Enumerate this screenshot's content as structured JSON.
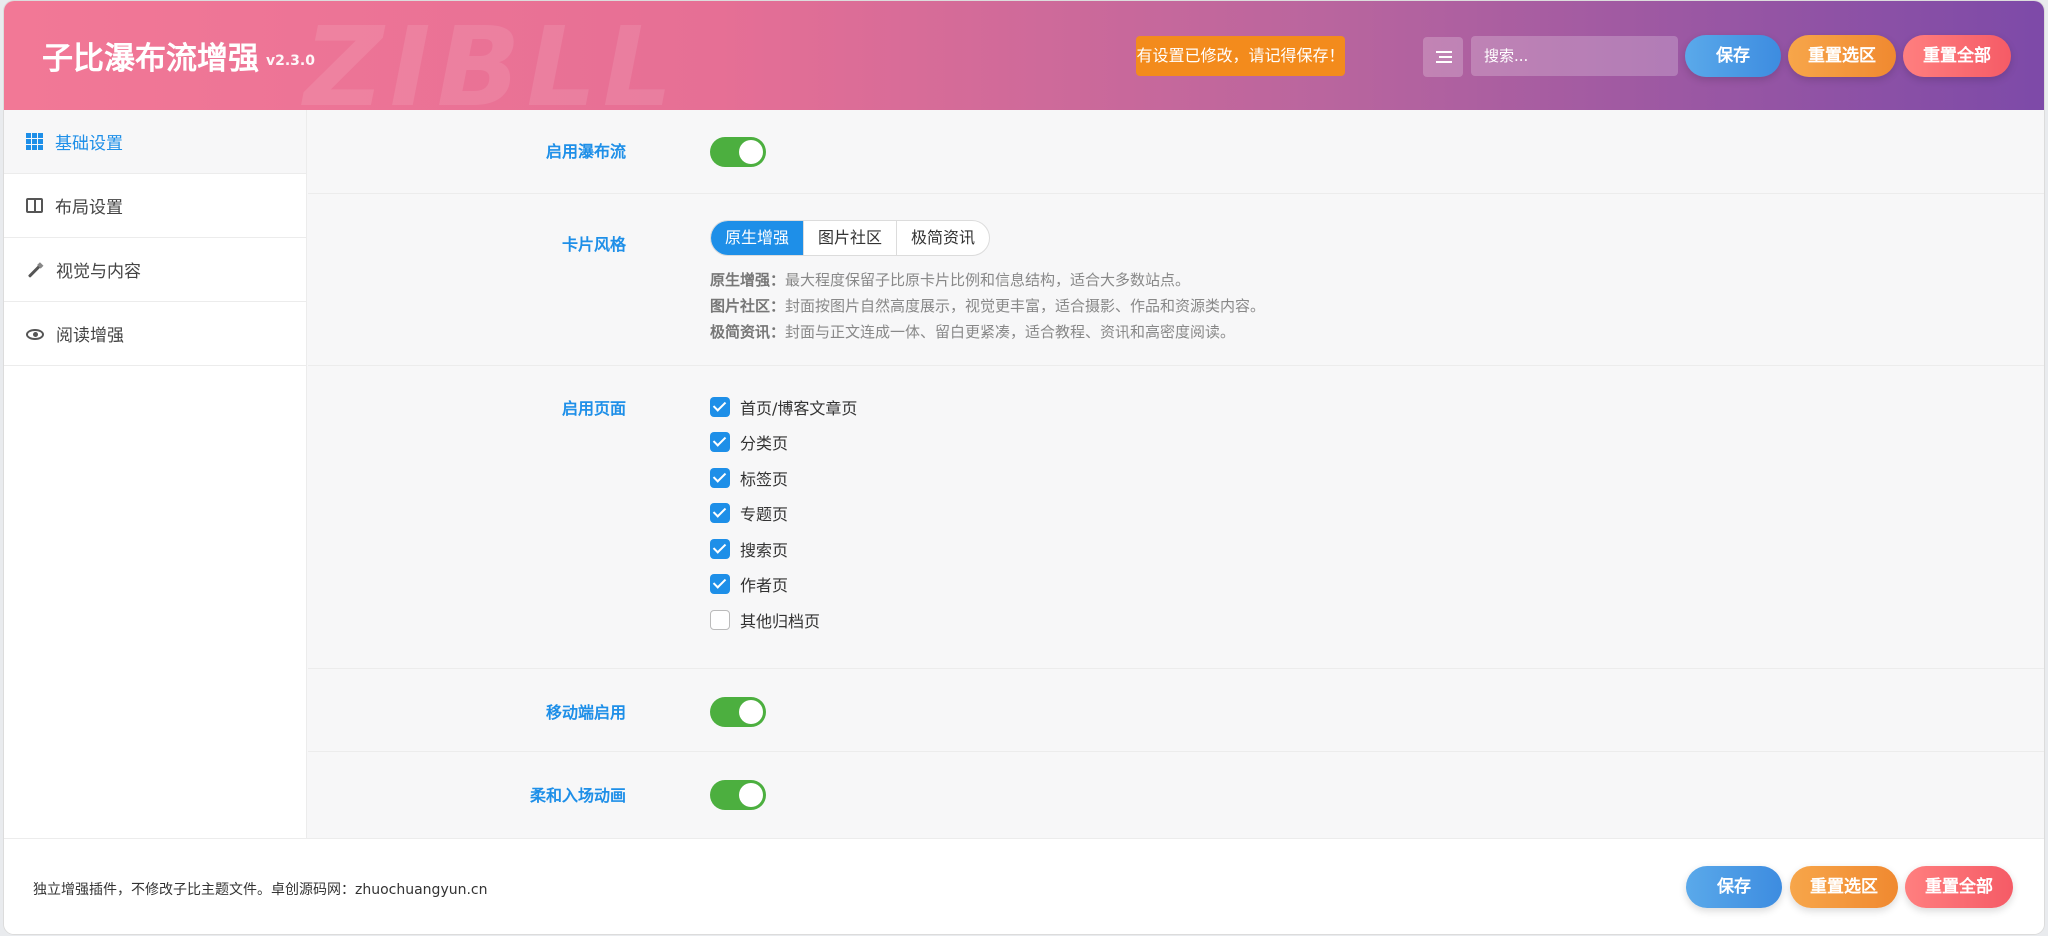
{
  "header": {
    "title": "子比瀑布流增强",
    "version": "v2.3.0",
    "watermark": "ZIBLL",
    "notice": "有设置已修改，请记得保存！",
    "search_placeholder": "搜索...",
    "save": "保存",
    "reset_section": "重置选区",
    "reset_all": "重置全部"
  },
  "sidebar": {
    "items": [
      {
        "label": "基础设置",
        "icon": "grid-icon",
        "active": true
      },
      {
        "label": "布局设置",
        "icon": "columns-icon"
      },
      {
        "label": "视觉与内容",
        "icon": "magic-wand-icon"
      },
      {
        "label": "阅读增强",
        "icon": "eye-icon"
      }
    ]
  },
  "settings": {
    "enable_waterfall": {
      "label": "启用瀑布流",
      "on": true
    },
    "card_style": {
      "label": "卡片风格",
      "options": [
        "原生增强",
        "图片社区",
        "极简资讯"
      ],
      "selected": "原生增强",
      "descriptions": [
        {
          "name": "原生增强：",
          "text": "最大程度保留子比原卡片比例和信息结构，适合大多数站点。"
        },
        {
          "name": "图片社区：",
          "text": "封面按图片自然高度展示，视觉更丰富，适合摄影、作品和资源类内容。"
        },
        {
          "name": "极简资讯：",
          "text": "封面与正文连成一体、留白更紧凑，适合教程、资讯和高密度阅读。"
        }
      ]
    },
    "enabled_pages": {
      "label": "启用页面",
      "items": [
        {
          "label": "首页/博客文章页",
          "checked": true
        },
        {
          "label": "分类页",
          "checked": true
        },
        {
          "label": "标签页",
          "checked": true
        },
        {
          "label": "专题页",
          "checked": true
        },
        {
          "label": "搜索页",
          "checked": true
        },
        {
          "label": "作者页",
          "checked": true
        },
        {
          "label": "其他归档页",
          "checked": false
        }
      ]
    },
    "mobile_enable": {
      "label": "移动端启用",
      "on": true
    },
    "soft_animation": {
      "label": "柔和入场动画",
      "on": true
    }
  },
  "footer": {
    "text": "独立增强插件，不修改子比主题文件。卓创源码网：zhuochuangyun.cn",
    "save": "保存",
    "reset_section": "重置选区",
    "reset_all": "重置全部"
  },
  "colors": {
    "accent": "#1e8fe8",
    "toggle_on": "#4caf3f",
    "notice": "#f38b1c"
  }
}
